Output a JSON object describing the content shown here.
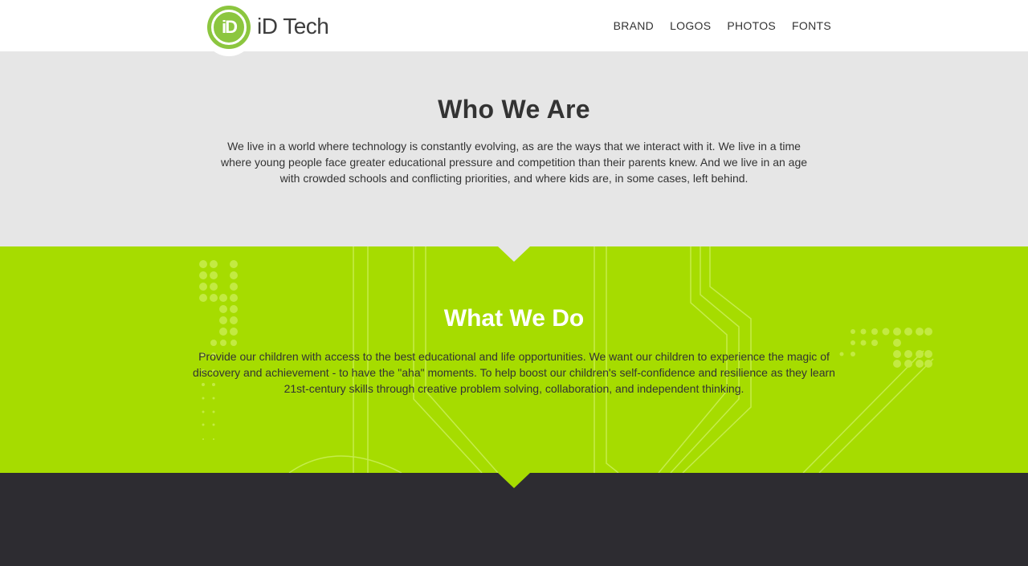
{
  "header": {
    "logo_mark": "iD",
    "logo_text": "iD Tech",
    "nav": [
      "BRAND",
      "LOGOS",
      "PHOTOS",
      "FONTS"
    ]
  },
  "who": {
    "title": "Who We Are",
    "body": "We live in a world where technology is constantly evolving, as are the ways that we interact with it. We live in a time where young people face greater educational pressure and competition than their parents knew. And we live in an age with crowded schools and conflicting priorities, and where kids are, in some cases, left behind."
  },
  "what": {
    "title": "What We Do",
    "body": "Provide our children with access to the best educational and life opportunities. We want our children to experience the magic of discovery and achievement - to have the \"aha\" moments. To help boost our children's self-confidence and resilience as they learn 21st-century skills through creative problem solving, collaboration, and independent thinking."
  },
  "colors": {
    "brand_green": "#8cc63f",
    "section_green": "#a6dc00",
    "section_gray": "#e6e6e6",
    "footer_dark": "#2d2c31"
  }
}
